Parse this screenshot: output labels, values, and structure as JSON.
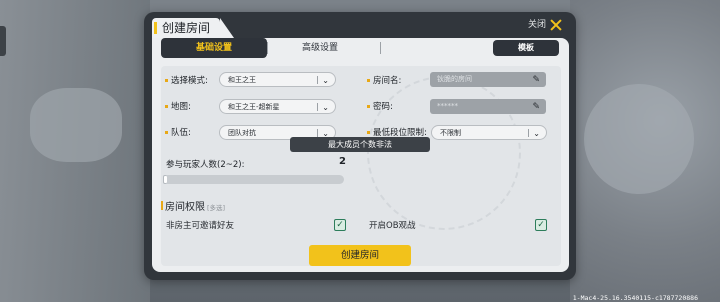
{
  "dialog": {
    "title": "创建房间",
    "close_label": "关闭"
  },
  "tabs": [
    {
      "label": "基础设置",
      "active": true
    },
    {
      "label": "高级设置",
      "active": false
    }
  ],
  "template_button": "模板",
  "form": {
    "mode": {
      "label": "选择模式:",
      "value": "和王之王"
    },
    "map": {
      "label": "地图:",
      "value": "和王之王-超新星"
    },
    "team": {
      "label": "队伍:",
      "value": "团队对抗"
    },
    "room_name": {
      "label": "房间名:",
      "placeholder": "钬脆的房间"
    },
    "password": {
      "label": "密码:",
      "value": "******"
    },
    "min_rank": {
      "label": "最低段位限制:",
      "value": "不限制"
    },
    "player_count": {
      "label": "参与玩家人数(2~2):",
      "value": "2",
      "slider_fraction": 0.02
    }
  },
  "toast": "最大成员个数非法",
  "permissions": {
    "title": "房间权限",
    "tag": "[多选]",
    "items": [
      {
        "label": "非房主可邀请好友",
        "checked": true
      },
      {
        "label": "开启OB观战",
        "checked": true
      }
    ]
  },
  "create_button": "创建房间",
  "version": "1-Mac4-25.16.3540115-c1787720886",
  "colors": {
    "accent": "#f2c21b",
    "panel": "#eceef0",
    "dark": "#2e333a"
  },
  "icons": {
    "close": "close-icon",
    "edit": "pencil-icon",
    "dropdown": "chevron-down-icon",
    "check": "check-icon"
  }
}
